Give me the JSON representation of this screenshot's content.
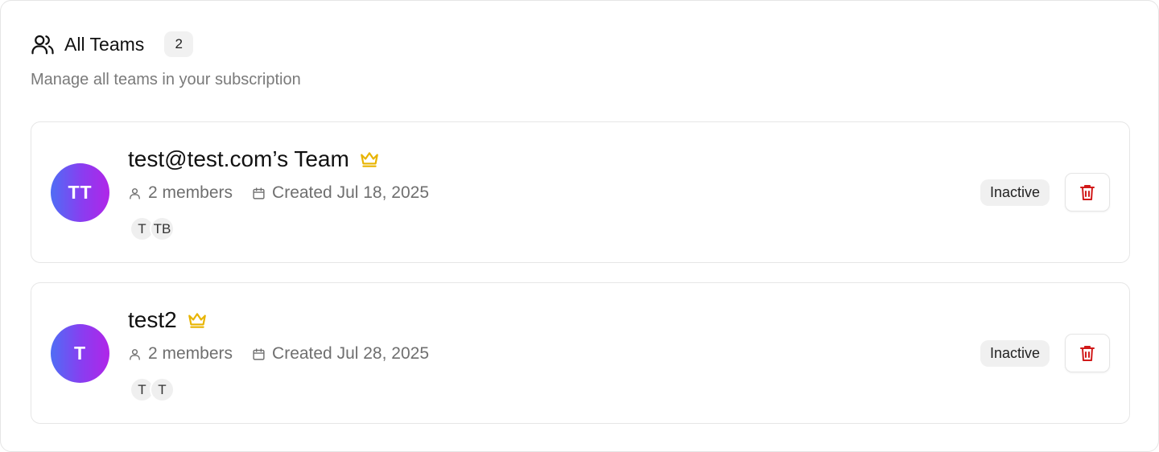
{
  "header": {
    "title": "All Teams",
    "count": "2",
    "subtitle": "Manage all teams in your subscription"
  },
  "colors": {
    "crown": "#e8b400",
    "delete": "#d11a1a",
    "avatar_gradient_start": "#4f6df5",
    "avatar_gradient_end": "#b026e8"
  },
  "teams": [
    {
      "initials": "TT",
      "name": "test@test.com’s Team",
      "members": "2 members",
      "created": "Created Jul 18, 2025",
      "member_avatars": [
        "T",
        "TB"
      ],
      "status": "Inactive"
    },
    {
      "initials": "T",
      "name": "test2",
      "members": "2 members",
      "created": "Created Jul 28, 2025",
      "member_avatars": [
        "T",
        "T"
      ],
      "status": "Inactive"
    }
  ]
}
